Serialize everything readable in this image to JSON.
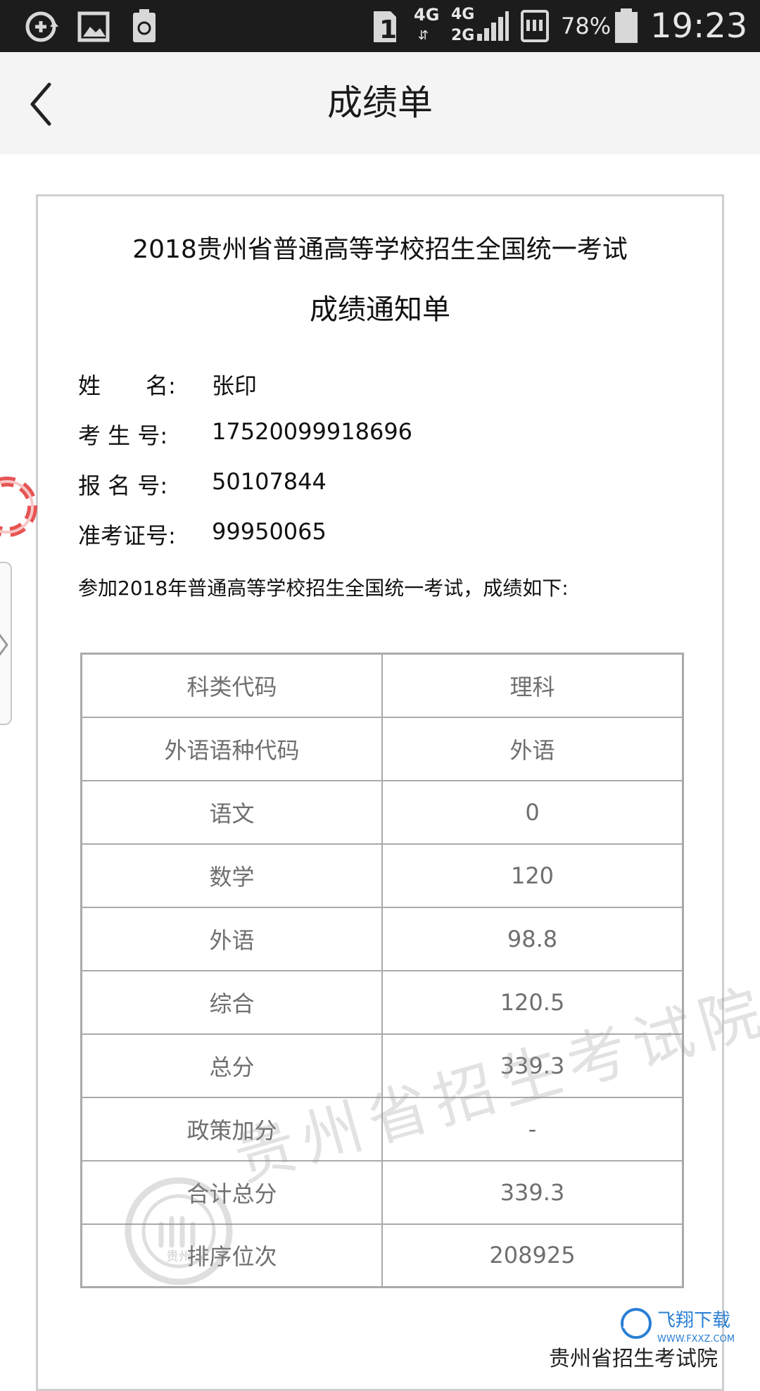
{
  "status_bar": {
    "sim_slot": "1",
    "net_top": "4G",
    "net_sim2_top": "4G",
    "net_sim2_bottom": "2G",
    "battery": "78%",
    "time": "19:23"
  },
  "nav": {
    "title": "成绩单"
  },
  "certificate": {
    "title": "2018贵州省普通高等学校招生全国统一考试",
    "subtitle": "成绩通知单",
    "info": [
      {
        "label": "姓　　名:",
        "value": "张印"
      },
      {
        "label": "考 生 号:",
        "value": "17520099918696"
      },
      {
        "label": "报 名 号:",
        "value": "50107844"
      },
      {
        "label": "准考证号:",
        "value": "99950065"
      }
    ],
    "intro": "参加2018年普通高等学校招生全国统一考试，成绩如下:",
    "scores": [
      {
        "label": "科类代码",
        "value": "理科"
      },
      {
        "label": "外语语种代码",
        "value": "外语"
      },
      {
        "label": "语文",
        "value": "0"
      },
      {
        "label": "数学",
        "value": "120"
      },
      {
        "label": "外语",
        "value": "98.8"
      },
      {
        "label": "综合",
        "value": "120.5"
      },
      {
        "label": "总分",
        "value": "339.3"
      },
      {
        "label": "政策加分",
        "value": "-"
      },
      {
        "label": "合计总分",
        "value": "339.3"
      },
      {
        "label": "排序位次",
        "value": "208925"
      }
    ],
    "watermark": "贵州省招生考试院",
    "seal_text": "贵州",
    "footer_org": "贵州省招生考试院"
  },
  "site_logo": {
    "text": "飞翔下载",
    "url_text": "WWW.FXXZ.COM"
  },
  "colors": {
    "status_bar_bg": "#1c1c1c",
    "nav_bg": "#f4f4f4",
    "table_border": "#aaaaaa",
    "table_text": "#6f6f6f",
    "float_ring": "#e75454",
    "logo_blue": "#2a7fd4"
  },
  "icons": {
    "status_left": [
      "sync-plus-icon",
      "gallery-icon",
      "recycle-battery-icon"
    ],
    "status_right": [
      "sim-card-icon",
      "signal-icon",
      "sms-icon",
      "battery-icon"
    ]
  }
}
